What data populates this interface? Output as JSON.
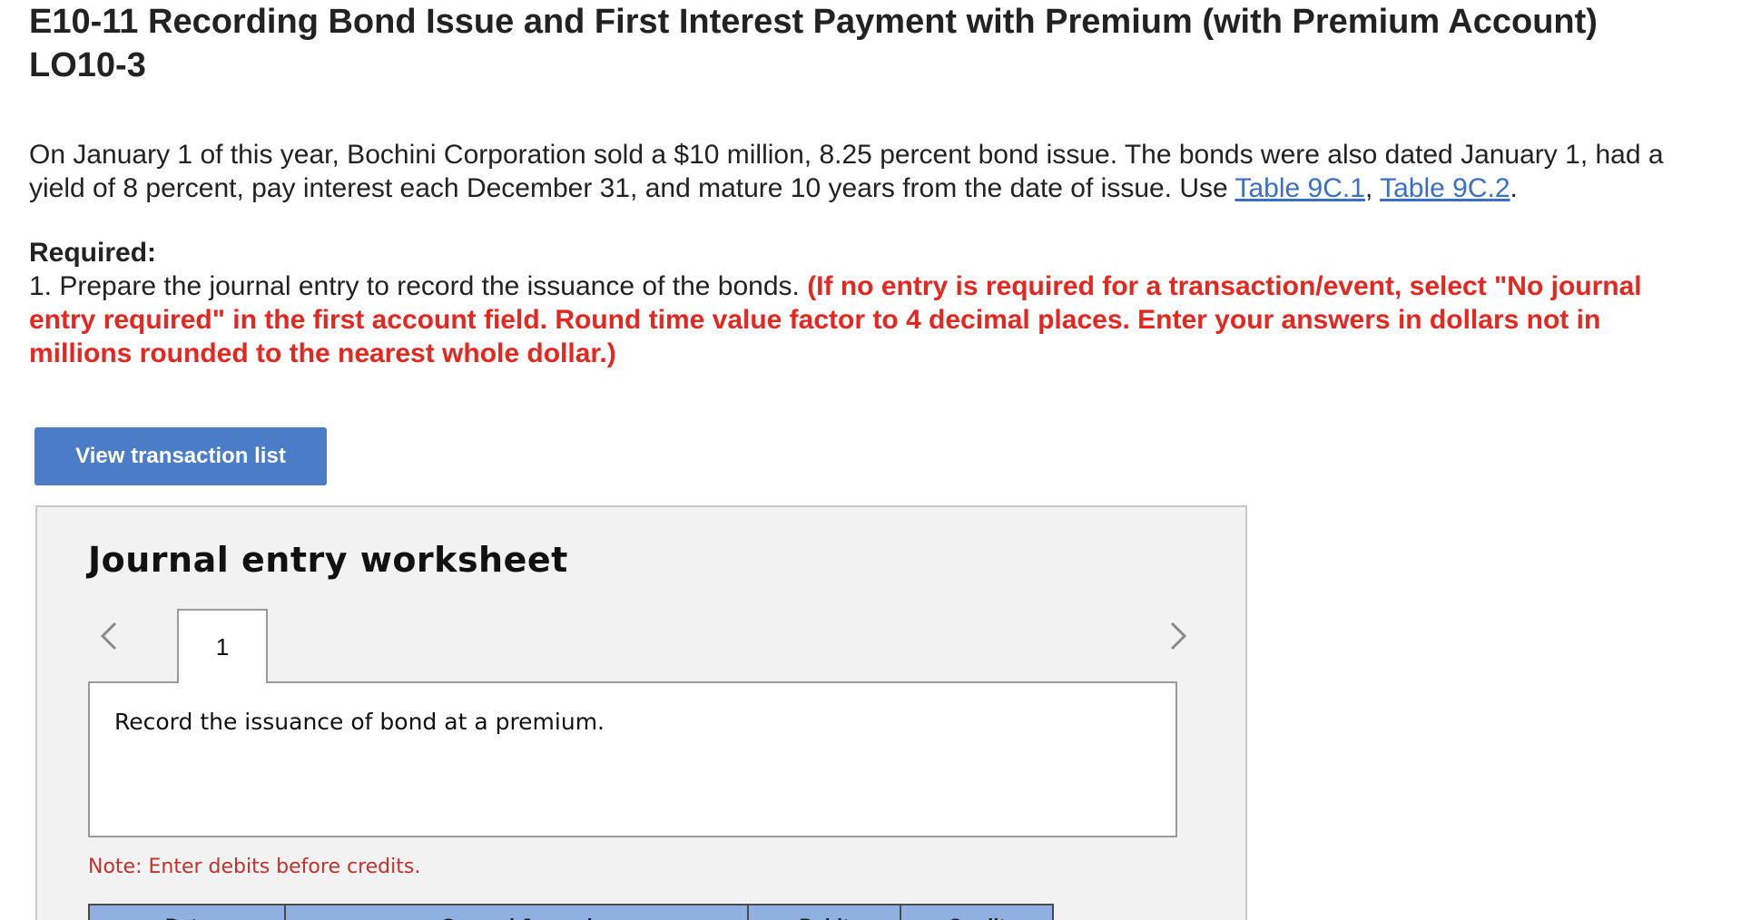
{
  "header": {
    "title": "E10-11 Recording Bond Issue and First Interest Payment with Premium (with Premium Account) LO10-3"
  },
  "problem": {
    "intro_text": "On January 1 of this year, Bochini Corporation sold a $10 million, 8.25 percent bond issue. The bonds were also dated January 1, had a yield of 8 percent, pay interest each December 31, and mature 10 years from the date of issue. Use ",
    "link_1": "Table 9C.1",
    "link_sep": ", ",
    "link_2": "Table 9C.2",
    "intro_end": "."
  },
  "required": {
    "label": "Required:",
    "item_text": "1. Prepare the journal entry to record the issuance of the bonds. ",
    "instruction": "(If no entry is required for a transaction/event, select \"No journal entry required\" in the first account field. Round time value factor to 4 decimal places. Enter your answers in dollars not in millions rounded to the nearest whole dollar.)"
  },
  "actions": {
    "view_transaction_list": "View transaction list"
  },
  "worksheet": {
    "title": "Journal entry worksheet",
    "active_tab": "1",
    "description": "Record the issuance of bond at a premium.",
    "note": "Note: Enter debits before credits.",
    "columns": [
      "Date",
      "General Journal",
      "Debit",
      "Credit"
    ],
    "icons": {
      "prev": "chevron-left-icon",
      "next": "chevron-right-icon"
    }
  },
  "colors": {
    "link": "#3a6fc4",
    "instruction_red": "#e5271f",
    "button_bg": "#4a7cc7",
    "table_header_bg": "#8fb0e0",
    "note_red": "#c0322b"
  }
}
